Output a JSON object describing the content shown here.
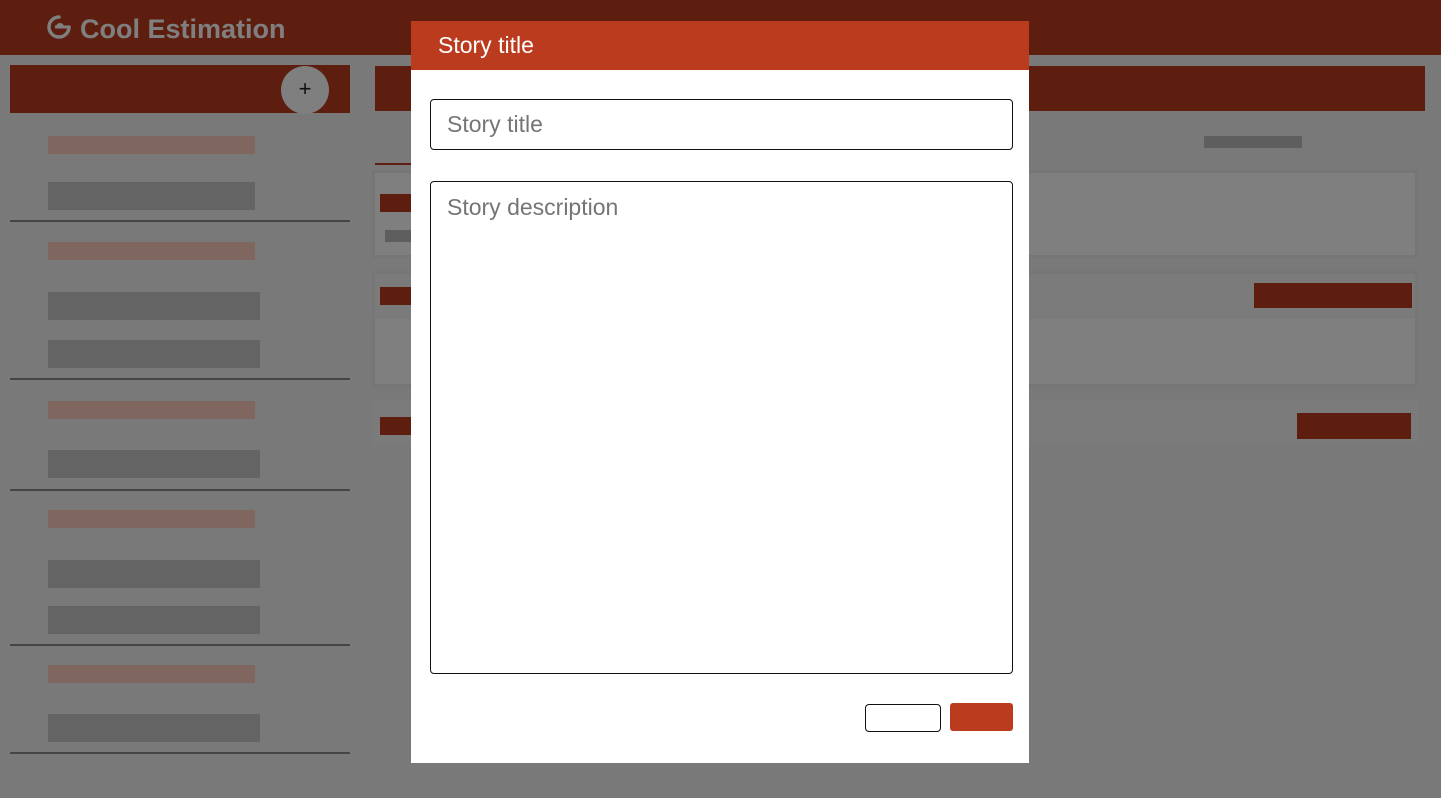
{
  "app": {
    "title": "Cool Estimation",
    "logo_icon": "estimation-logo-icon",
    "add_button_label": "+"
  },
  "dialog": {
    "header_title": "Story title",
    "title_field": {
      "placeholder": "Story title",
      "value": ""
    },
    "description_field": {
      "placeholder": "Story description",
      "value": ""
    },
    "cancel_label": "",
    "save_label": ""
  },
  "colors": {
    "brand": "#bb3b1f",
    "overlay": "rgba(0,0,0,0.5)",
    "placeholder_title": "#ffcfc1",
    "placeholder_line": "#c9c9c9"
  }
}
